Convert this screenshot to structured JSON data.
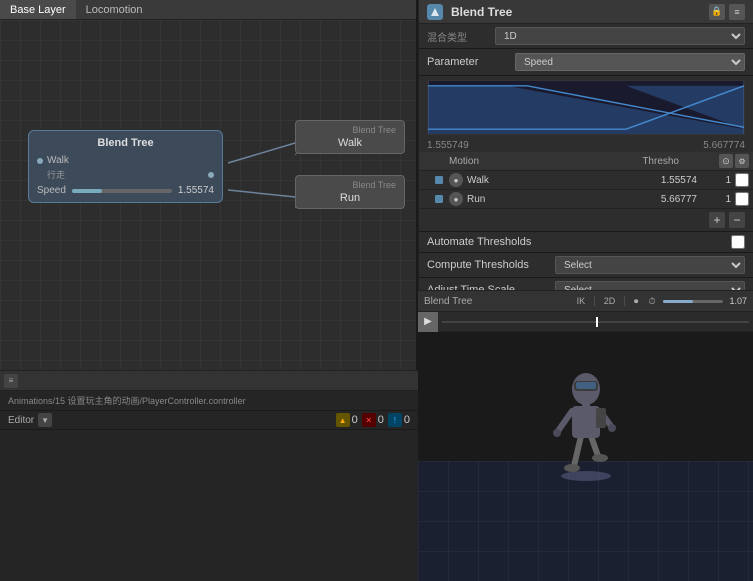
{
  "tabs": {
    "base_layer": "Base Layer",
    "locomotion": "Locomotion"
  },
  "blend_tree_node": {
    "title": "Blend Tree",
    "walk_label": "Walk",
    "walk_zh": "行走",
    "speed_label": "Speed",
    "speed_value": "1.55574"
  },
  "walk_node": {
    "label": "Walk",
    "conn_label": "Blend Tree"
  },
  "run_node": {
    "label": "Run",
    "conn_label": "Blend Tree"
  },
  "right_panel": {
    "title": "Blend Tree",
    "mix_type_label": "混合类型",
    "mix_type_value": "1D",
    "parameter_label": "Parameter",
    "parameter_value": "Speed",
    "range_min": "1.555749",
    "range_max": "5.667774",
    "motion_col": "Motion",
    "threshold_col": "Thresho",
    "walk_name": "Walk",
    "walk_threshold": "1.55574",
    "walk_num": "1",
    "run_name": "Run",
    "run_threshold": "5.66777",
    "run_num": "1",
    "automate_label": "Automate Thresholds",
    "compute_label": "Compute Thresholds",
    "compute_select": "Select",
    "adjust_label": "Adjust Time Scale",
    "adjust_select": "Select"
  },
  "playback": {
    "title": "Blend Tree",
    "ik_label": "IK",
    "twod_label": "2D",
    "speed_value": "1.07"
  },
  "bottom": {
    "editor_label": "Editor",
    "path": "Animations/15 设置玩主角的动画/PlayerController.controller",
    "warning_count": "0",
    "error_count": "0",
    "info_count": "0"
  },
  "icons": {
    "arrow_right": "▶",
    "arrow_down": "▼",
    "plus": "+",
    "minus": "−",
    "gear": "⚙",
    "lock": "🔒",
    "play": "▶",
    "dot": "●",
    "check": "✓",
    "menu": "≡",
    "close": "✕",
    "grid": "⊞"
  }
}
